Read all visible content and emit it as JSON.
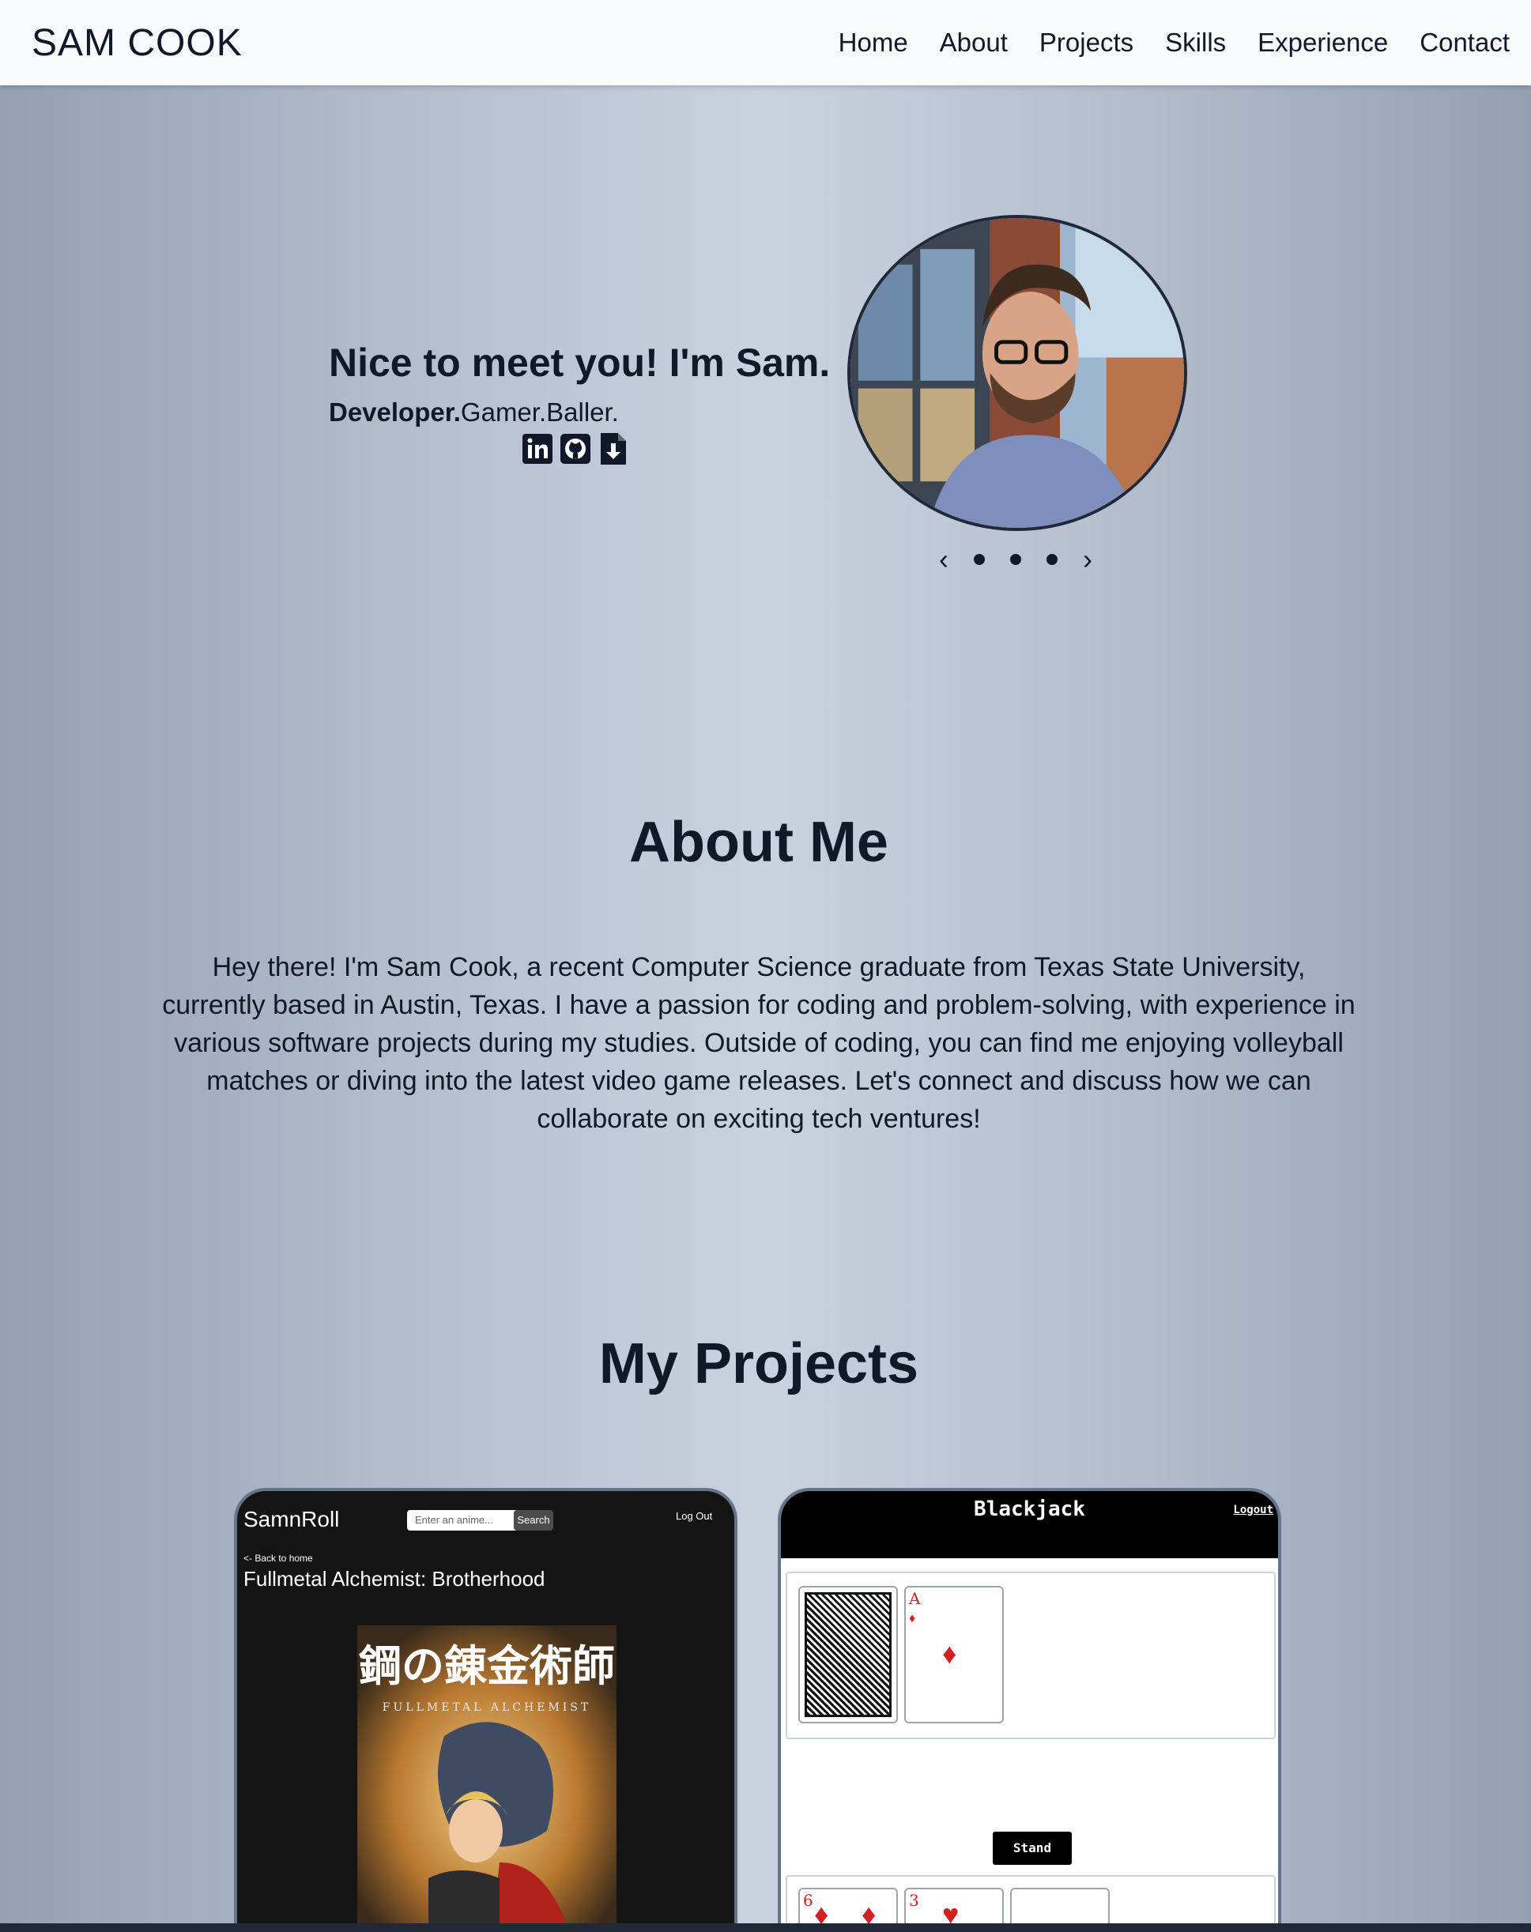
{
  "nav": {
    "brand": "SAM COOK",
    "links": [
      "Home",
      "About",
      "Projects",
      "Skills",
      "Experience",
      "Contact"
    ]
  },
  "hero": {
    "title": "Nice to meet you! I'm Sam.",
    "subtitle_bold": "Developer.",
    "subtitle_rest": "Gamer.Baller.",
    "socials": [
      "linkedin-icon",
      "github-icon",
      "resume-download-icon"
    ]
  },
  "about": {
    "title": "About Me",
    "text": "Hey there! I'm Sam Cook, a recent Computer Science graduate from Texas State University, currently based in Austin, Texas. I have a passion for coding and problem-solving, with experience in various software projects during my studies. Outside of coding, you can find me enjoying volleyball matches or diving into the latest video game releases. Let's connect and discuss how we can collaborate on exciting tech ventures!"
  },
  "projects": {
    "title": "My Projects",
    "anime": {
      "brand": "SamnRoll",
      "search_placeholder": "Enter an anime...",
      "search_button": "Search",
      "logout": "Log Out",
      "back": "<- Back to home",
      "show_title": "Fullmetal Alchemist: Brotherhood",
      "poster_title": "鋼の錬金術師",
      "poster_subtitle": "FULLMETAL ALCHEMIST"
    },
    "blackjack": {
      "title": "Blackjack",
      "logout": "Logout",
      "stand": "Stand",
      "dealer_card_rank": "A",
      "player_card1_rank": "6",
      "player_card2_rank": "3"
    }
  },
  "colors": {
    "text": "#111827",
    "suit_red": "#d21f1f"
  }
}
